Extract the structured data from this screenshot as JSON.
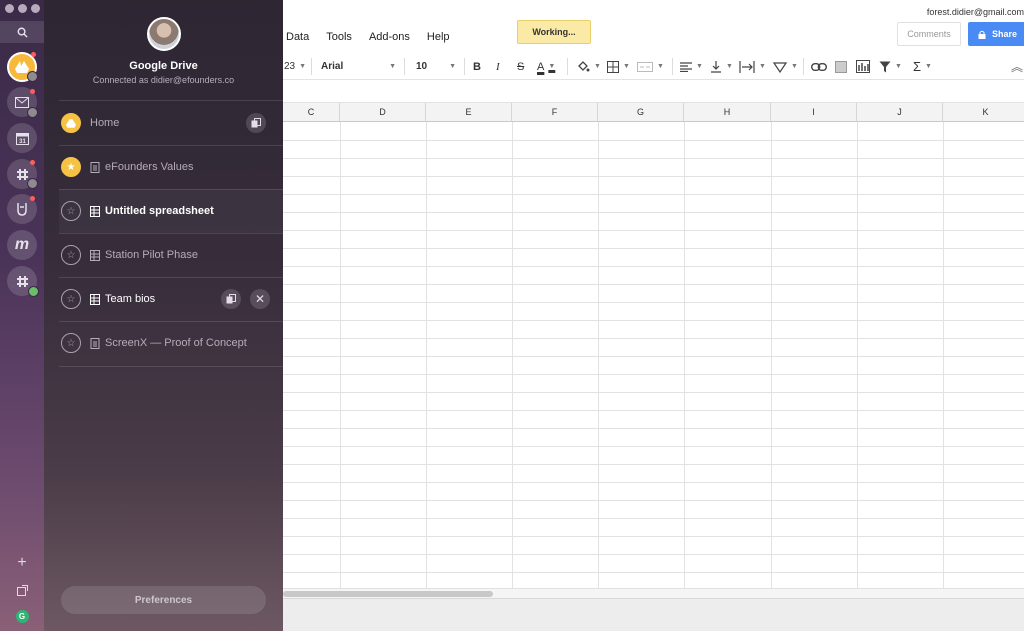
{
  "rail": {
    "icons": [
      "search-icon",
      "google-drive-icon",
      "gmail-icon",
      "calendar-icon",
      "slack-icon",
      "rock-hand-icon",
      "medium-icon",
      "slack-icon-2"
    ],
    "bottom": [
      "add-icon",
      "external-icon",
      "grammarly-icon"
    ]
  },
  "panel": {
    "title": "Google Drive",
    "subtitle": "Connected as didier@efounders.co",
    "items": [
      {
        "label": "Home",
        "icon": "google-drive-icon"
      },
      {
        "label": "eFounders Values",
        "icon": "document-icon"
      },
      {
        "label": "Untitled spreadsheet",
        "icon": "spreadsheet-icon"
      },
      {
        "label": "Station Pilot Phase",
        "icon": "spreadsheet-icon"
      },
      {
        "label": "Team bios",
        "icon": "spreadsheet-icon"
      },
      {
        "label": "ScreenX — Proof of Concept",
        "icon": "document-icon"
      }
    ],
    "preferences": "Preferences"
  },
  "sheet": {
    "email": "forest.didier@gmail.com",
    "status": "Working...",
    "menu": [
      "Data",
      "Tools",
      "Add-ons",
      "Help"
    ],
    "comments": "Comments",
    "share": "Share",
    "toolbar": {
      "zoom_fragment": "23",
      "font": "Arial",
      "font_size": "10",
      "bold": "B",
      "italic": "I",
      "strike": "S",
      "text_color": "A",
      "sigma": "Σ"
    },
    "columns": [
      "C",
      "D",
      "E",
      "F",
      "G",
      "H",
      "I",
      "J",
      "K"
    ]
  },
  "colors": {
    "accent_blue": "#4a8af4",
    "drive_yellow": "#f6c244",
    "working_bg": "#fbeaa5"
  }
}
